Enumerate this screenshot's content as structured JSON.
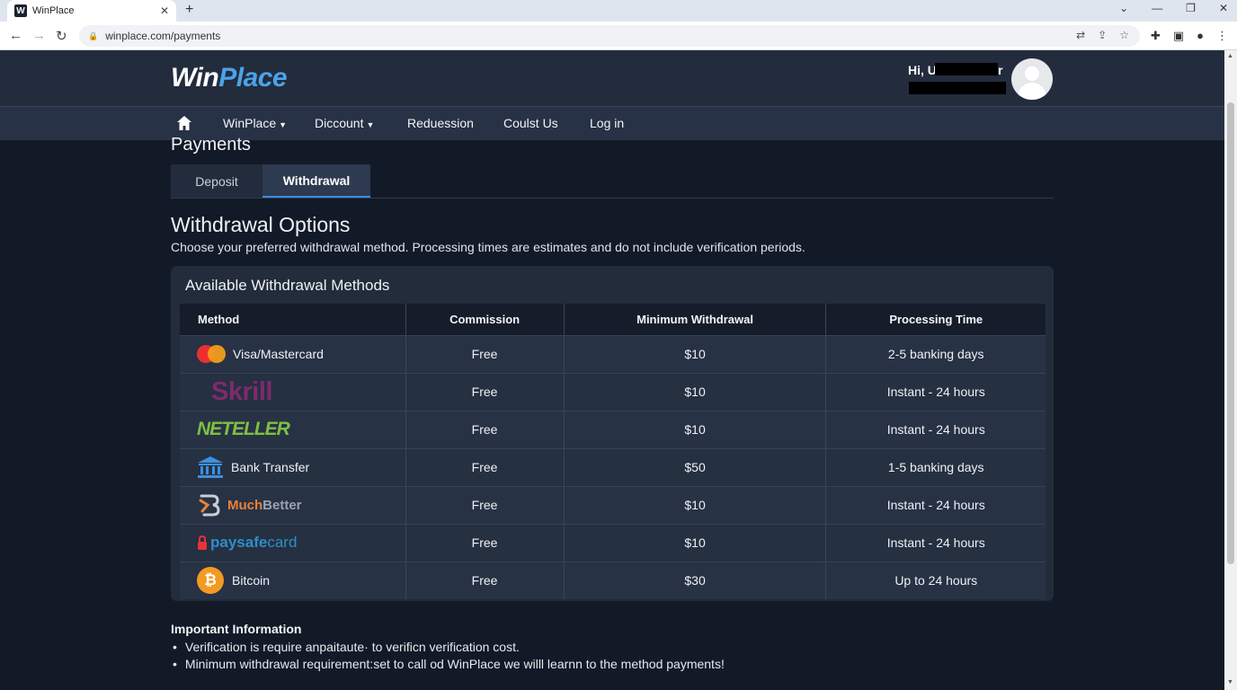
{
  "browser": {
    "tab_title": "WinPlace",
    "favicon_letter": "W",
    "url": "winplace.com/payments"
  },
  "site": {
    "logo_win": "Win",
    "logo_place": "Place",
    "greeting": "Hi, U",
    "greeting_end": "r",
    "nav": [
      {
        "label": "WinPlace",
        "dropdown": true
      },
      {
        "label": "Diccount",
        "dropdown": true
      },
      {
        "label": "Reduession",
        "dropdown": false
      },
      {
        "label": "Coulst Us",
        "dropdown": false
      },
      {
        "label": "Log in",
        "dropdown": false
      }
    ]
  },
  "page": {
    "title": "Payments",
    "tabs": [
      "Deposit",
      "Withdrawal"
    ],
    "active_tab": "Withdrawal",
    "section_title": "Withdrawal Options",
    "section_desc": "Choose your preferred withdrawal method. Processing times are estimates and do not include verification periods."
  },
  "table": {
    "card_title": "Available Withdrawal Methods",
    "headers": [
      "Method",
      "Commission",
      "Minimum Withdrawal",
      "Processing Time"
    ],
    "rows": [
      {
        "method": "Visa/Mastercard",
        "icon": "mastercard-icon",
        "commission": "Free",
        "minimum": "$10",
        "time": "2-5 banking days"
      },
      {
        "method": "Skrill",
        "icon": "skrill-logo",
        "commission": "Free",
        "minimum": "$10",
        "time": "Instant - 24 hours"
      },
      {
        "method": "NETELLER",
        "icon": "neteller-logo",
        "commission": "Free",
        "minimum": "$10",
        "time": "Instant - 24 hours"
      },
      {
        "method": "Bank Transfer",
        "icon": "bank-icon",
        "commission": "Free",
        "minimum": "$50",
        "time": "1-5 banking days"
      },
      {
        "method": "MuchBetter",
        "method_a": "Much",
        "method_b": "Better",
        "icon": "muchbetter-icon",
        "commission": "Free",
        "minimum": "$10",
        "time": "Instant - 24 hours"
      },
      {
        "method": "paysafecard",
        "method_a": "paysafe",
        "method_b": "card",
        "icon": "paysafecard-lock-icon",
        "commission": "Free",
        "minimum": "$10",
        "time": "Instant - 24 hours"
      },
      {
        "method": "Bitcoin",
        "icon": "bitcoin-icon",
        "icon_glyph": "₿",
        "commission": "Free",
        "minimum": "$30",
        "time": "Up to 24 hours"
      }
    ]
  },
  "info": {
    "title": "Important Information",
    "items": [
      "Verification is require anpaitaute· to verificn verification cost.",
      "Minimum withdrawal requirement:set to call od WinPlace we willl learnn to the method payments!"
    ]
  },
  "colors": {
    "brand_blue": "#4aa3e8",
    "page_bg": "#131a27",
    "header_bg": "#232c3d",
    "active_tab_accent": "#3a8ee6"
  }
}
